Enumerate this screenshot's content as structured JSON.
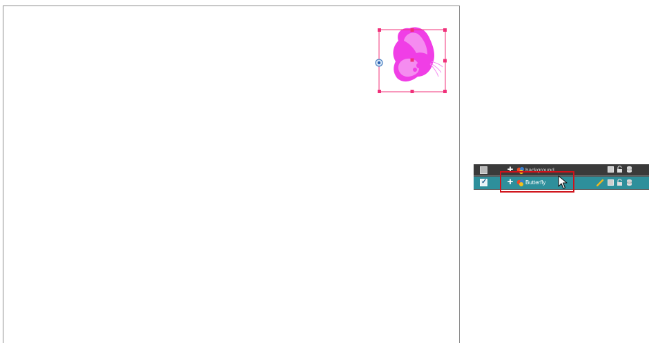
{
  "stage": {
    "object": "Butterfly",
    "selection_color": "#f0307a",
    "butterfly_color": "#f03ee6"
  },
  "timeline": {
    "layers": [
      {
        "name": "background",
        "visible_checked": false,
        "selected": false,
        "icon": "drawing-layer-icon"
      },
      {
        "name": "Butterfly",
        "visible_checked": true,
        "selected": true,
        "icon": "drawing-layer-icon"
      }
    ],
    "selected_row_color": "#2e8f9b",
    "highlight_color": "#d0121a"
  }
}
